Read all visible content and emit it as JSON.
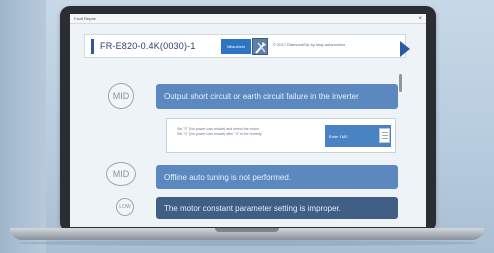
{
  "window": {
    "title": "Fault Repair",
    "close_glyph": "×"
  },
  "header": {
    "model": "FR-E820-0.4K(0030)-1",
    "logo_label": "Mitsubishi",
    "copyright": "© 2017 Diamond/Op by long autonomics"
  },
  "causes": [
    {
      "badge": "MID",
      "text": "Output short circuit or earth circuit failure in the inverter"
    },
    {
      "badge": "MID",
      "text": "Offline auto tuning is not performed."
    },
    {
      "badge": "LOW",
      "text": "The motor constant parameter setting is improper."
    }
  ],
  "remedy": {
    "text_line1": "Set \"0\" (No power loss restart) and select the motor.",
    "text_line2": "Set \"0\" (No power loss restart) after \"0\" is the remedy.",
    "manual_label": "Enter 1M2"
  },
  "icons": {
    "tool": "screwdriver-wrench-icon",
    "next": "chevron-right-icon",
    "manual": "document-icon"
  },
  "colors": {
    "accent": "#2c5aa0",
    "cause_bar": "#5a88bf",
    "cause_bar_dark": "#3f5f85"
  }
}
